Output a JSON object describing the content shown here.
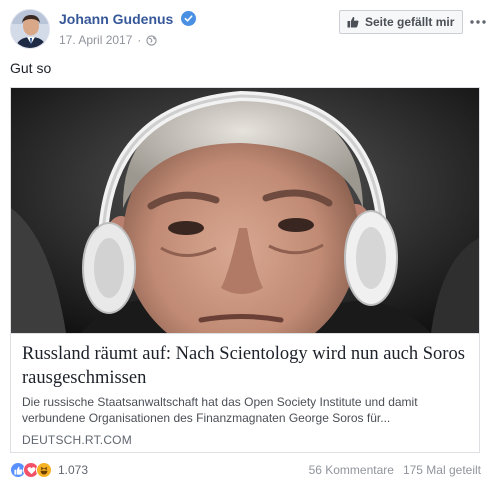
{
  "header": {
    "author": "Johann Gudenus",
    "date": "17. April 2017",
    "separator": "·",
    "like_page_label": "Seite gefällt mir"
  },
  "post": {
    "text": "Gut so"
  },
  "link": {
    "title": "Russland räumt auf: Nach Scientology wird nun auch Soros rausgeschmissen",
    "description": "Die russische Staatsanwaltschaft hat das Open Society Institute und damit verbundene Organisationen des Finanzmagnaten George Soros für...",
    "domain": "DEUTSCH.RT.COM"
  },
  "footer": {
    "reaction_count": "1.073",
    "comments": "56 Kommentare",
    "shares": "175 Mal geteilt"
  },
  "colors": {
    "link_blue": "#365899",
    "verified": "#4a90e2",
    "like_blue": "#5890ff",
    "love_red": "#f25268",
    "haha_yellow": "#f7b125"
  }
}
